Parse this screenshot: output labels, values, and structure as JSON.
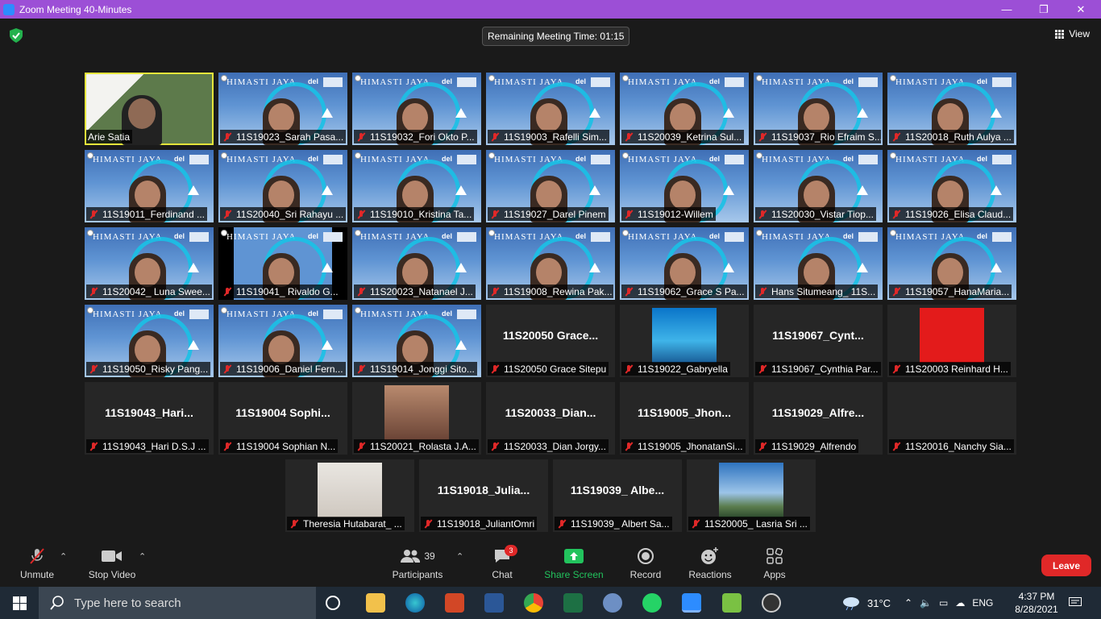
{
  "window": {
    "title": "Zoom Meeting 40-Minutes",
    "minimize": "—",
    "maximize": "❐",
    "close": "✕"
  },
  "meeting": {
    "remaining": "Remaining Meeting Time: 01:15",
    "view_label": "View"
  },
  "tiles": [
    {
      "label": "Arie Satia",
      "type": "campus"
    },
    {
      "label": "11S19023_Sarah Pasa...",
      "type": "vid"
    },
    {
      "label": "11S19032_Fori Okto P...",
      "type": "vid"
    },
    {
      "label": "11S19003_Rafelli Sim...",
      "type": "vid"
    },
    {
      "label": "11S20039_Ketrina Sul...",
      "type": "vid"
    },
    {
      "label": "11S19037_Rio Efraim S...",
      "type": "vid"
    },
    {
      "label": "11S20018_Ruth Aulya ...",
      "type": "vid"
    },
    {
      "label": "11S19011_Ferdinand ...",
      "type": "vid"
    },
    {
      "label": "11S20040_Sri Rahayu ...",
      "type": "vid"
    },
    {
      "label": "11S19010_Kristina Ta...",
      "type": "vid"
    },
    {
      "label": "11S19027_Darel Pinem",
      "type": "vid"
    },
    {
      "label": "11S19012-Willem",
      "type": "vid"
    },
    {
      "label": "11S20030_Vistar Tiop...",
      "type": "vid"
    },
    {
      "label": "11S19026_Elisa Claud...",
      "type": "vid"
    },
    {
      "label": "11S20042_ Luna Swee...",
      "type": "vid"
    },
    {
      "label": "11S19041_ Rivaldo G...",
      "type": "dark"
    },
    {
      "label": "11S20023_Natanael J...",
      "type": "vid"
    },
    {
      "label": "11S19008_Rewina Pak...",
      "type": "vid"
    },
    {
      "label": "11S19062_Grace S Pa...",
      "type": "vid"
    },
    {
      "label": "Hans Situmeang_ 11S...",
      "type": "vid"
    },
    {
      "label": "11S19057_HanaMaria...",
      "type": "vid"
    },
    {
      "label": "11S19050_Risky Pang...",
      "type": "vid"
    },
    {
      "label": "11S19006_Daniel Fern...",
      "type": "vid"
    },
    {
      "label": "11S19014_Jonggi Sito...",
      "type": "vid"
    },
    {
      "label": "11S20050 Grace Sitepu",
      "type": "plain",
      "big": "11S20050 Grace..."
    },
    {
      "label": "11S19022_Gabryella",
      "type": "sea"
    },
    {
      "label": "11S19067_Cynthia Par...",
      "type": "plain",
      "big": "11S19067_Cynt..."
    },
    {
      "label": "11S20003 Reinhard H...",
      "type": "red"
    },
    {
      "label": "11S19043_Hari D.S.J ...",
      "type": "plain",
      "big": "11S19043_Hari..."
    },
    {
      "label": "11S19004 Sophian N...",
      "type": "plain",
      "big": "11S19004  Sophi..."
    },
    {
      "label": "11S20021_Rolasta J.A...",
      "type": "room"
    },
    {
      "label": "11S20033_Dian Jorgy...",
      "type": "plain",
      "big": "11S20033_Dian..."
    },
    {
      "label": "11S19005_JhonatanSi...",
      "type": "plain",
      "big": "11S19005_Jhon..."
    },
    {
      "label": "11S19029_Alfrendo",
      "type": "plain",
      "big": "11S19029_Alfre..."
    },
    {
      "label": "11S20016_Nanchy Sia...",
      "type": "blank"
    },
    {
      "label": "Theresia Hutabarat_ ...",
      "type": "selfie"
    },
    {
      "label": "11S19018_JuliantOmri",
      "type": "plain",
      "big": "11S19018_Julia..."
    },
    {
      "label": "11S19039_ Albert Sa...",
      "type": "plain",
      "big": "11S19039_ Albe..."
    },
    {
      "label": "11S20005_ Lasria Sri ...",
      "type": "sky"
    }
  ],
  "tile_brand": "HIMASTI JAYA",
  "tile_del": "del",
  "toolbar": {
    "unmute": "Unmute",
    "stop_video": "Stop Video",
    "participants": "Participants",
    "participants_count": "39",
    "chat": "Chat",
    "chat_badge": "3",
    "share_screen": "Share Screen",
    "record": "Record",
    "reactions": "Reactions",
    "apps": "Apps",
    "leave": "Leave"
  },
  "taskbar": {
    "search_placeholder": "Type here to search",
    "weather": "31°C",
    "lang": "ENG",
    "time": "4:37 PM",
    "date": "8/28/2021"
  },
  "colors": {
    "title_bar": "#9c4fd6",
    "leave": "#e02828",
    "share_green": "#22c35d",
    "active_speaker": "#e5e53b"
  }
}
